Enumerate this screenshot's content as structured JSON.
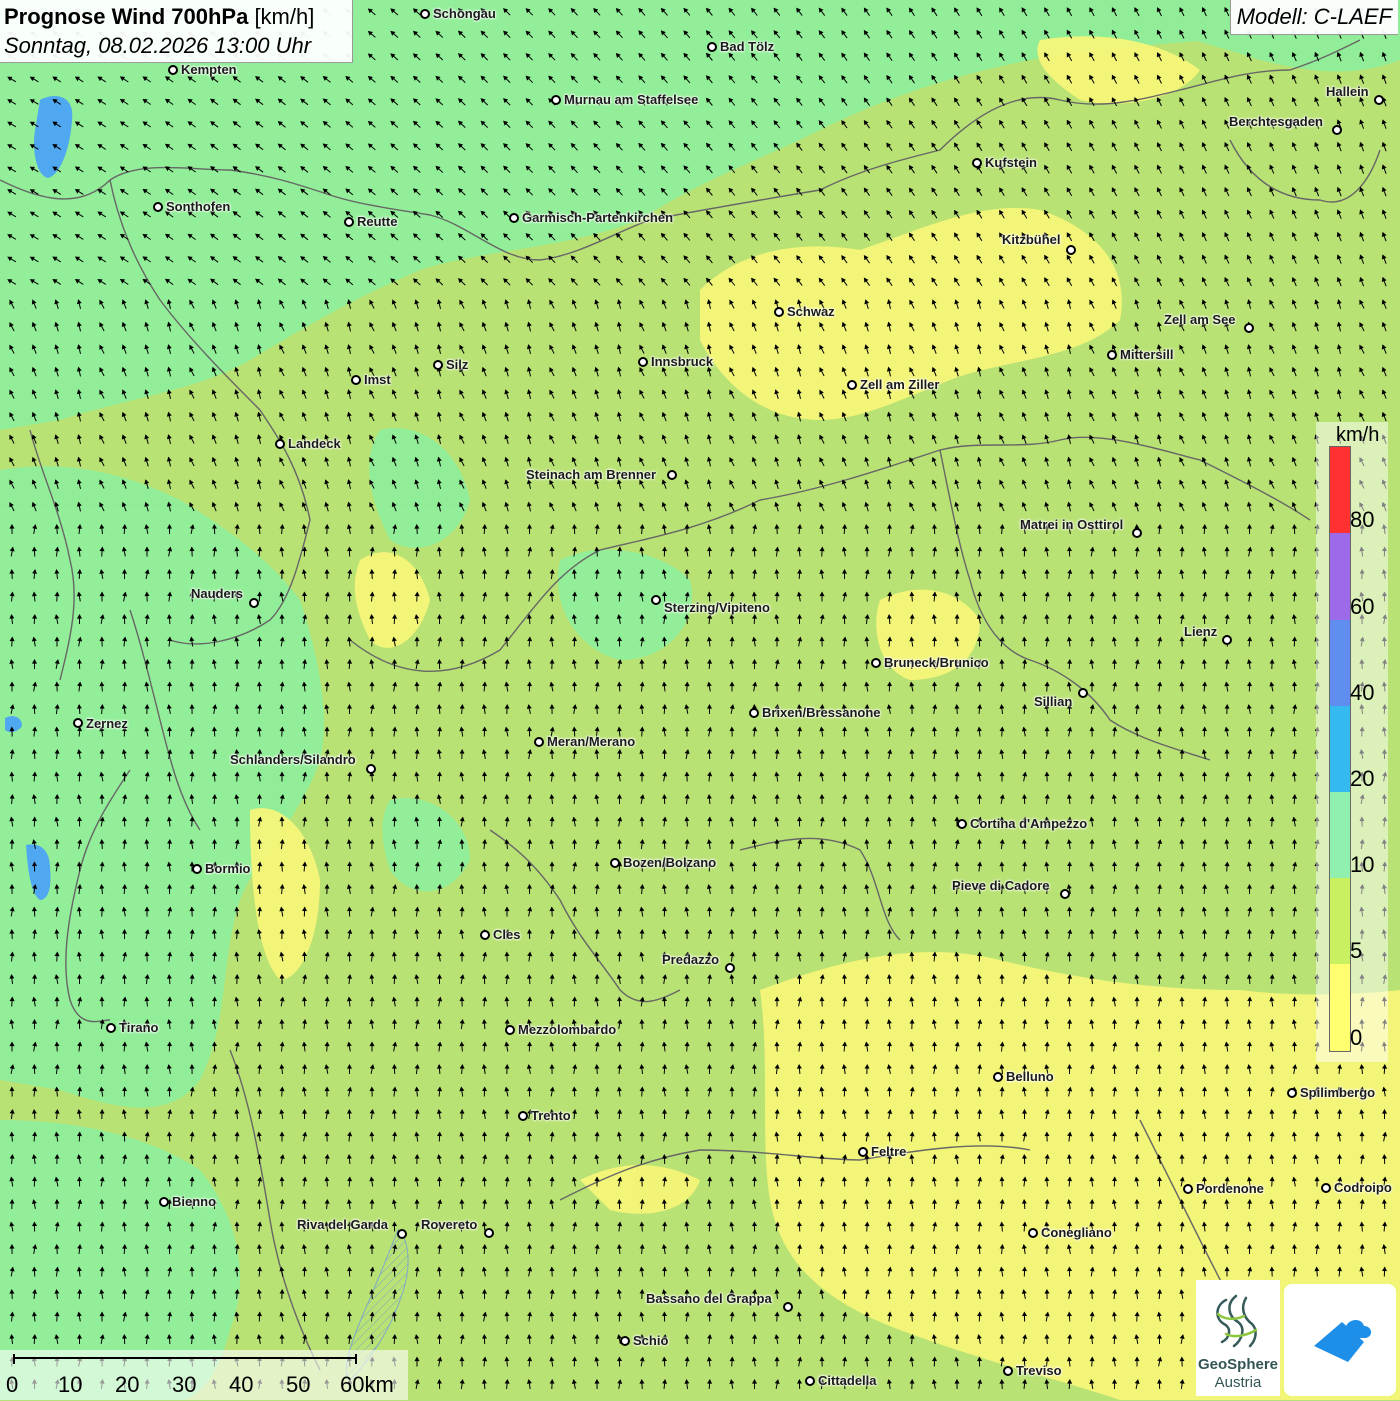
{
  "header": {
    "title_bold": "Prognose Wind 700hPa",
    "title_unit": "[km/h]",
    "datetime": "Sonntag, 08.02.2026 13:00 Uhr"
  },
  "model_label": "Modell: C-LAEF",
  "legend": {
    "unit": "km/h",
    "ticks": [
      "80",
      "60",
      "40",
      "20",
      "10",
      "5",
      "0"
    ],
    "colors": [
      "#ff3030",
      "#9d6bea",
      "#5f8ef0",
      "#35baf0",
      "#8ff0b0",
      "#c8f060",
      "#ffff70"
    ]
  },
  "scalebar": {
    "labels": [
      "0",
      "10",
      "20",
      "30",
      "40",
      "50",
      "60km"
    ]
  },
  "logo": {
    "name_line1": "GeoSphere",
    "name_line2": "Austria"
  },
  "wind": {
    "prevailing_direction": "south to north",
    "range_kmh": "0-20"
  },
  "colors": {
    "calm": "#ffff70",
    "light": "#c8f060",
    "moderate": "#8ff0b0",
    "arrow": "#000000"
  },
  "cities": [
    {
      "name": "Schongau"
    },
    {
      "name": "Bad Tölz"
    },
    {
      "name": "Kempten"
    },
    {
      "name": "Murnau am Staffelsee"
    },
    {
      "name": "Hallein"
    },
    {
      "name": "Berchtesgaden"
    },
    {
      "name": "Kufstein"
    },
    {
      "name": "Sonthofen"
    },
    {
      "name": "Reutte"
    },
    {
      "name": "Garmisch-Partenkirchen"
    },
    {
      "name": "Kitzbühel"
    },
    {
      "name": "Schwaz"
    },
    {
      "name": "Zell am See"
    },
    {
      "name": "Mittersill"
    },
    {
      "name": "Silz"
    },
    {
      "name": "Innsbruck"
    },
    {
      "name": "Imst"
    },
    {
      "name": "Zell am Ziller"
    },
    {
      "name": "Landeck"
    },
    {
      "name": "Steinach am Brenner"
    },
    {
      "name": "Matrei in Osttirol"
    },
    {
      "name": "Nauders"
    },
    {
      "name": "Sterzing/Vipiteno"
    },
    {
      "name": "Lienz"
    },
    {
      "name": "Bruneck/Brunico"
    },
    {
      "name": "Sillian"
    },
    {
      "name": "Zernez"
    },
    {
      "name": "Brixen/Bressanone"
    },
    {
      "name": "Meran/Merano"
    },
    {
      "name": "Schlanders/Silandro"
    },
    {
      "name": "Cortina d'Ampezzo"
    },
    {
      "name": "Bozen/Bolzano"
    },
    {
      "name": "Bormio"
    },
    {
      "name": "Pieve di Cadore"
    },
    {
      "name": "Cles"
    },
    {
      "name": "Predazzo"
    },
    {
      "name": "Tirano"
    },
    {
      "name": "Mezzolombardo"
    },
    {
      "name": "Belluno"
    },
    {
      "name": "Spilimbergo"
    },
    {
      "name": "Trento"
    },
    {
      "name": "Feltre"
    },
    {
      "name": "Pordenone"
    },
    {
      "name": "Codroipo"
    },
    {
      "name": "Bienno"
    },
    {
      "name": "Riva del Garda"
    },
    {
      "name": "Rovereto"
    },
    {
      "name": "Conegliano"
    },
    {
      "name": "Bassano del Grappa"
    },
    {
      "name": "Schio"
    },
    {
      "name": "Treviso"
    },
    {
      "name": "Cittadella"
    }
  ]
}
